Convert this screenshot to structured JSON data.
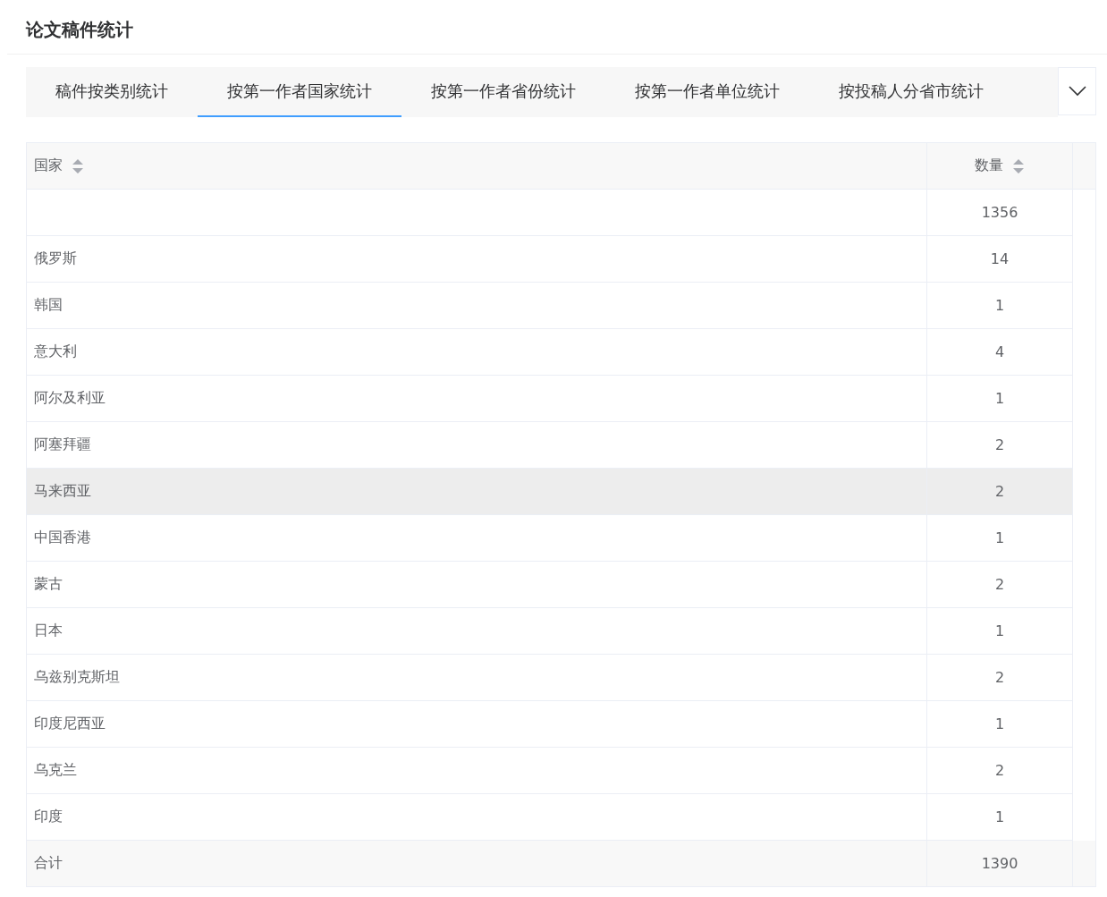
{
  "page_title": "论文稿件统计",
  "tabs": [
    {
      "label": "稿件按类别统计",
      "selected": false
    },
    {
      "label": "按第一作者国家统计",
      "selected": true
    },
    {
      "label": "按第一作者省份统计",
      "selected": false
    },
    {
      "label": "按第一作者单位统计",
      "selected": false
    },
    {
      "label": "按投稿人分省市统计",
      "selected": false
    }
  ],
  "table": {
    "columns": [
      "国家",
      "数量"
    ],
    "rows": [
      {
        "country": "",
        "count": "1356",
        "highlighted": false
      },
      {
        "country": "俄罗斯",
        "count": "14",
        "highlighted": false
      },
      {
        "country": "韩国",
        "count": "1",
        "highlighted": false
      },
      {
        "country": "意大利",
        "count": "4",
        "highlighted": false
      },
      {
        "country": "阿尔及利亚",
        "count": "1",
        "highlighted": false
      },
      {
        "country": "阿塞拜疆",
        "count": "2",
        "highlighted": false
      },
      {
        "country": "马来西亚",
        "count": "2",
        "highlighted": true
      },
      {
        "country": "中国香港",
        "count": "1",
        "highlighted": false
      },
      {
        "country": "蒙古",
        "count": "2",
        "highlighted": false
      },
      {
        "country": "日本",
        "count": "1",
        "highlighted": false
      },
      {
        "country": "乌兹别克斯坦",
        "count": "2",
        "highlighted": false
      },
      {
        "country": "印度尼西亚",
        "count": "1",
        "highlighted": false
      },
      {
        "country": "乌克兰",
        "count": "2",
        "highlighted": false
      },
      {
        "country": "印度",
        "count": "1",
        "highlighted": false
      }
    ],
    "total": {
      "label": "合计",
      "count": "1390"
    }
  }
}
